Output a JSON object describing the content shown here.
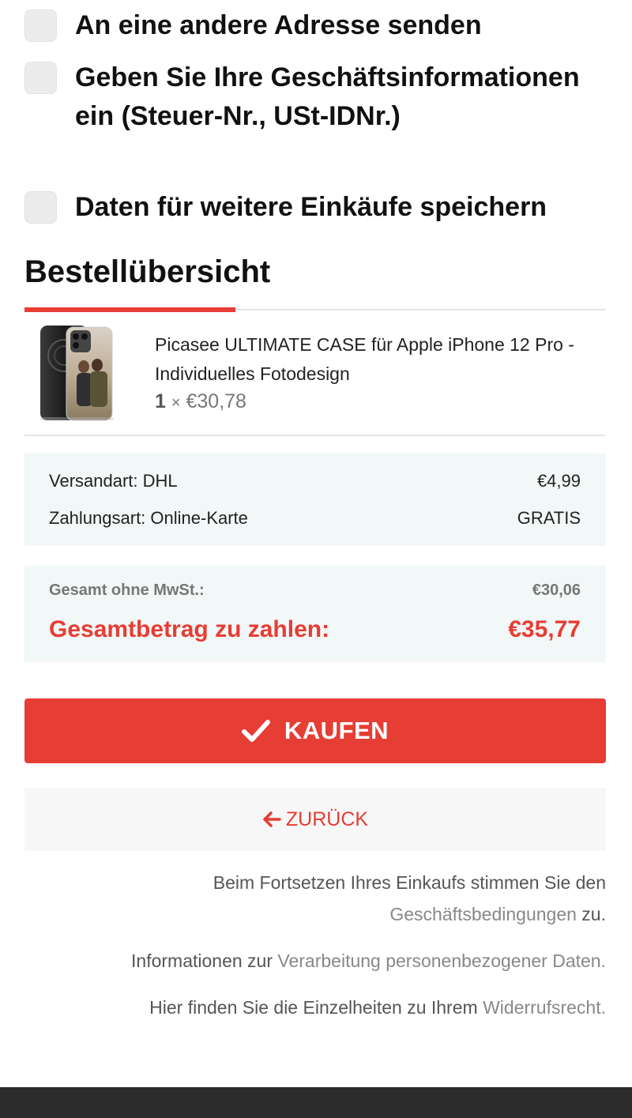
{
  "options": [
    {
      "label": "An eine andere Adresse senden",
      "checked": false
    },
    {
      "label": "Geben Sie Ihre Geschäftsinformationen ein (Steuer-Nr., USt-IDNr.)",
      "checked": false
    },
    {
      "label": "Daten für weitere Einkäufe speichern",
      "checked": false
    }
  ],
  "order_summary": {
    "title": "Bestellübersicht",
    "item": {
      "name": "Picasee ULTIMATE CASE für Apple iPhone 12 Pro - Individuelles Fotodesign",
      "quantity": "1",
      "times": "×",
      "unit_price": "€30,78"
    },
    "shipping": {
      "label": "Versandart: DHL",
      "value": "€4,99"
    },
    "payment": {
      "label": "Zahlungsart: Online-Karte",
      "value": "GRATIS"
    },
    "net_total": {
      "label": "Gesamt ohne MwSt.:",
      "value": "€30,06"
    },
    "grand_total": {
      "label": "Gesamtbetrag zu zahlen:",
      "value": "€35,77"
    }
  },
  "actions": {
    "buy_label": "KAUFEN",
    "back_label": "ZURÜCK"
  },
  "legal": {
    "terms_prefix": "Beim Fortsetzen Ihres Einkaufs stimmen Sie den ",
    "terms_link": "Geschäftsbedingungen",
    "terms_suffix": " zu.",
    "privacy_prefix": "Informationen zur ",
    "privacy_link": "Verarbeitung personenbezogener Daten.",
    "withdrawal_prefix": "Hier finden Sie die Einzelheiten zu Ihrem ",
    "withdrawal_link": "Widerrufsrecht."
  },
  "colors": {
    "accent": "#e63d34",
    "summary_bg": "#f2f7f7",
    "checkbox_bg": "#ececec",
    "footer_bg": "#2c2c2c"
  }
}
